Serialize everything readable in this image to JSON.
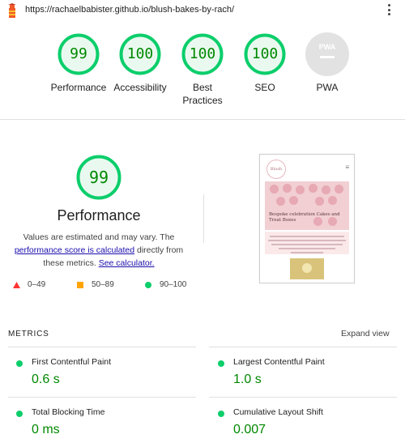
{
  "header": {
    "url": "https://rachaelbabister.github.io/blush-bakes-by-rach/"
  },
  "colors": {
    "pass": "#0cce6b",
    "pass_text": "#008800",
    "average": "#ffa400",
    "fail": "#ff3333",
    "link": "#1a0dab"
  },
  "categories": [
    {
      "score": "99",
      "label": "Performance"
    },
    {
      "score": "100",
      "label": "Accessibility"
    },
    {
      "score": "100",
      "label": "Best Practices"
    },
    {
      "score": "100",
      "label": "SEO"
    },
    {
      "score": "",
      "label": "PWA",
      "badge": "PWA"
    }
  ],
  "performance": {
    "score": "99",
    "title": "Performance",
    "desc_pre": "Values are estimated and may vary. The ",
    "desc_link1": "performance score is calculated",
    "desc_mid": " directly from these metrics. ",
    "desc_link2": "See calculator.",
    "legend": [
      {
        "range": "0–49",
        "icon": "triangle-icon"
      },
      {
        "range": "50–89",
        "icon": "square-icon"
      },
      {
        "range": "90–100",
        "icon": "circle-icon"
      }
    ]
  },
  "screenshot": {
    "logo_text": "Blush Bakes",
    "hero_text": "Bespoke celebration Cakes and Treat Boxes"
  },
  "metrics": {
    "title": "METRICS",
    "expand_label": "Expand view",
    "items": [
      {
        "name": "First Contentful Paint",
        "value": "0.6 s"
      },
      {
        "name": "Largest Contentful Paint",
        "value": "1.0 s"
      },
      {
        "name": "Total Blocking Time",
        "value": "0 ms"
      },
      {
        "name": "Cumulative Layout Shift",
        "value": "0.007"
      }
    ]
  }
}
